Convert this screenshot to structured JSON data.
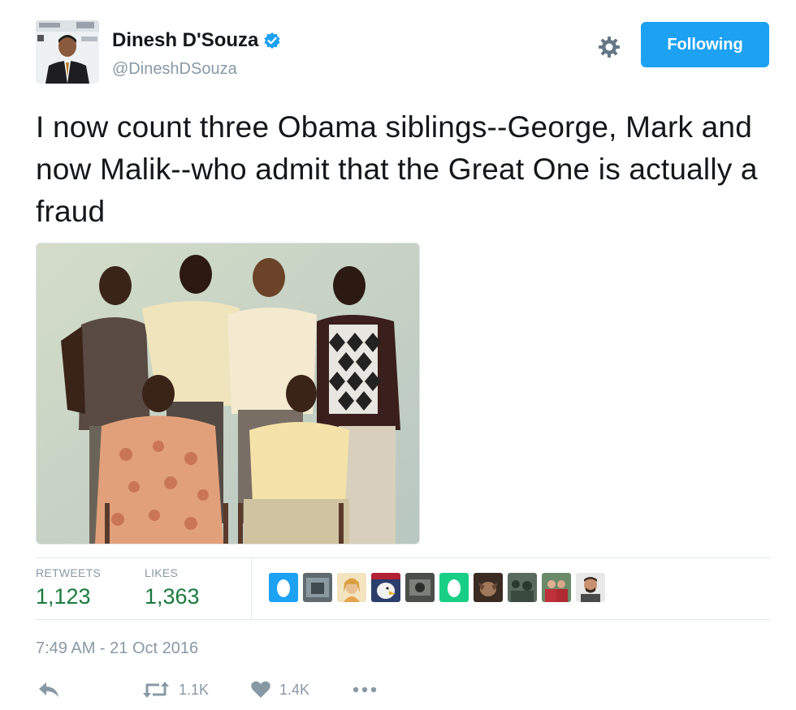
{
  "author": {
    "name": "Dinesh D'Souza",
    "handle": "@DineshDSouza",
    "verified": true
  },
  "header": {
    "follow_label": "Following",
    "settings_icon": "gear-icon",
    "accent_color": "#1da1f2"
  },
  "tweet": {
    "text": "I now count three Obama siblings--George, Mark and now Malik--who admit that the Great One is actually a fraud"
  },
  "stats": {
    "retweets_label": "RETWEETS",
    "retweets_value": "1,123",
    "likes_label": "LIKES",
    "likes_value": "1,363"
  },
  "liked_by_avatars": [
    "egg-avatar",
    "photo-avatar",
    "photo-avatar",
    "eagle-avatar",
    "egg-avatar-green",
    "photo-avatar",
    "photo-avatar",
    "photo-avatar",
    "photo-avatar"
  ],
  "timestamp": "7:49 AM - 21 Oct 2016",
  "actions": {
    "reply_icon": "reply-icon",
    "retweet_count": "1.1K",
    "like_count": "1.4K",
    "more_icon": "more-icon"
  }
}
